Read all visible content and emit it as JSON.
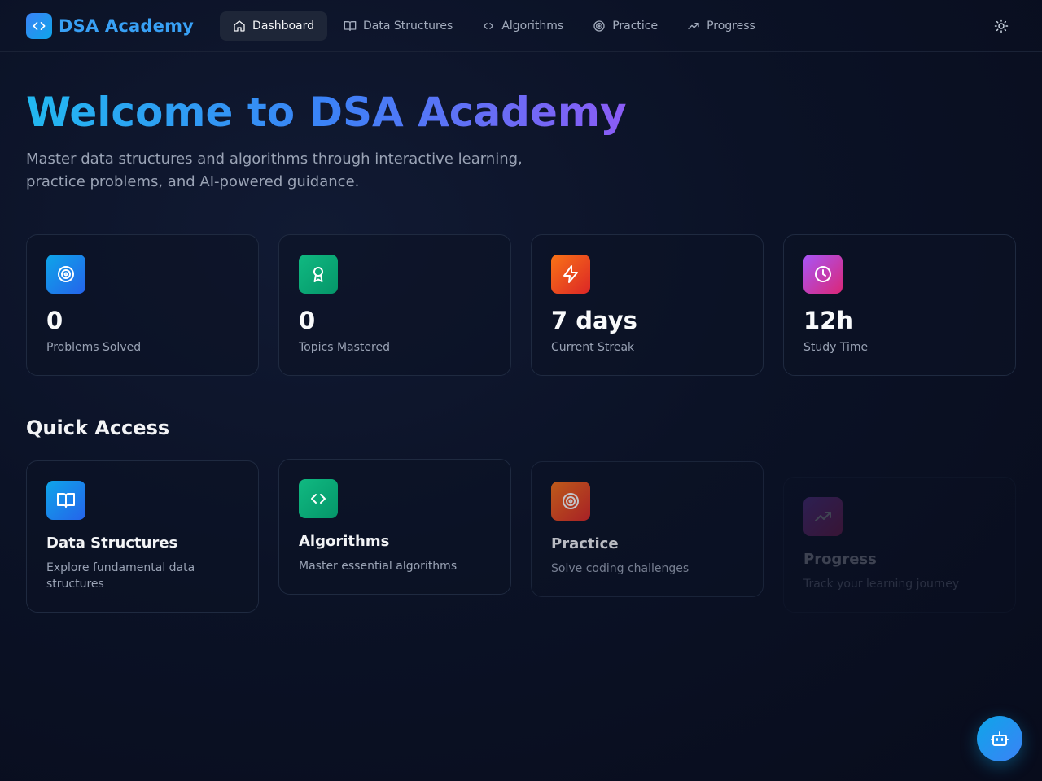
{
  "brand": {
    "name": "DSA Academy"
  },
  "nav": {
    "items": [
      {
        "label": "Dashboard",
        "icon": "home-icon",
        "active": true
      },
      {
        "label": "Data Structures",
        "icon": "book-icon"
      },
      {
        "label": "Algorithms",
        "icon": "code-icon"
      },
      {
        "label": "Practice",
        "icon": "target-icon"
      },
      {
        "label": "Progress",
        "icon": "trending-up-icon"
      }
    ],
    "theme_icon": "sun-icon"
  },
  "hero": {
    "title": "Welcome to DSA Academy",
    "subtitle": "Master data structures and algorithms through interactive learning, practice problems, and AI-powered guidance."
  },
  "stats": [
    {
      "value": "0",
      "label": "Problems Solved",
      "icon": "target-icon",
      "color_from": "#0ea5e9",
      "color_to": "#2563eb"
    },
    {
      "value": "0",
      "label": "Topics Mastered",
      "icon": "award-icon",
      "color_from": "#10b981",
      "color_to": "#059669"
    },
    {
      "value": "7 days",
      "label": "Current Streak",
      "icon": "zap-icon",
      "color_from": "#f97316",
      "color_to": "#dc2626"
    },
    {
      "value": "12h",
      "label": "Study Time",
      "icon": "clock-icon",
      "color_from": "#a855f7",
      "color_to": "#db2777"
    }
  ],
  "quick_access": {
    "title": "Quick Access",
    "cards": [
      {
        "title": "Data Structures",
        "desc": "Explore fundamental data structures",
        "icon": "book-icon"
      },
      {
        "title": "Algorithms",
        "desc": "Master essential algorithms",
        "icon": "code-icon"
      },
      {
        "title": "Practice",
        "desc": "Solve coding challenges",
        "icon": "target-icon"
      },
      {
        "title": "Progress",
        "desc": "Track your learning journey",
        "icon": "trending-up-icon"
      }
    ]
  },
  "fab": {
    "icon": "bot-icon"
  }
}
